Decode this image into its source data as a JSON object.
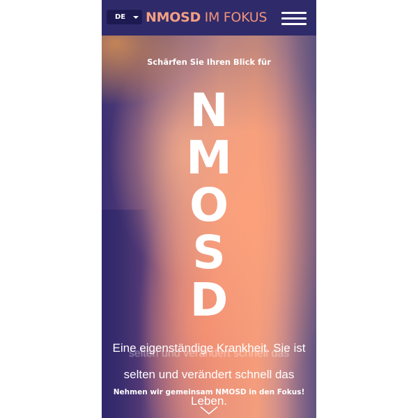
{
  "header": {
    "language": "DE",
    "brand_primary": "NMOSD",
    "brand_secondary": " IM FOKUS",
    "menu_icon": "hamburger-menu-icon"
  },
  "hero": {
    "tagline": "Schärfen Sie Ihren Blick für",
    "letters": [
      "N",
      "M",
      "O",
      "S",
      "D"
    ],
    "ghost_text": "selten und verändert schnell das",
    "headline": "Eine eigenständige Krankheit. Sie ist selten und verändert schnell das Leben.",
    "cta": "Nehmen wir gemeinsam NMOSD in den Fokus!",
    "scroll_icon": "chevron-down-icon"
  },
  "colors": {
    "header_bg": "#2f2a6a",
    "brand_accent": "#f4a082",
    "gradient_purple": "#3a2e72",
    "gradient_peach": "#f4a07e"
  }
}
